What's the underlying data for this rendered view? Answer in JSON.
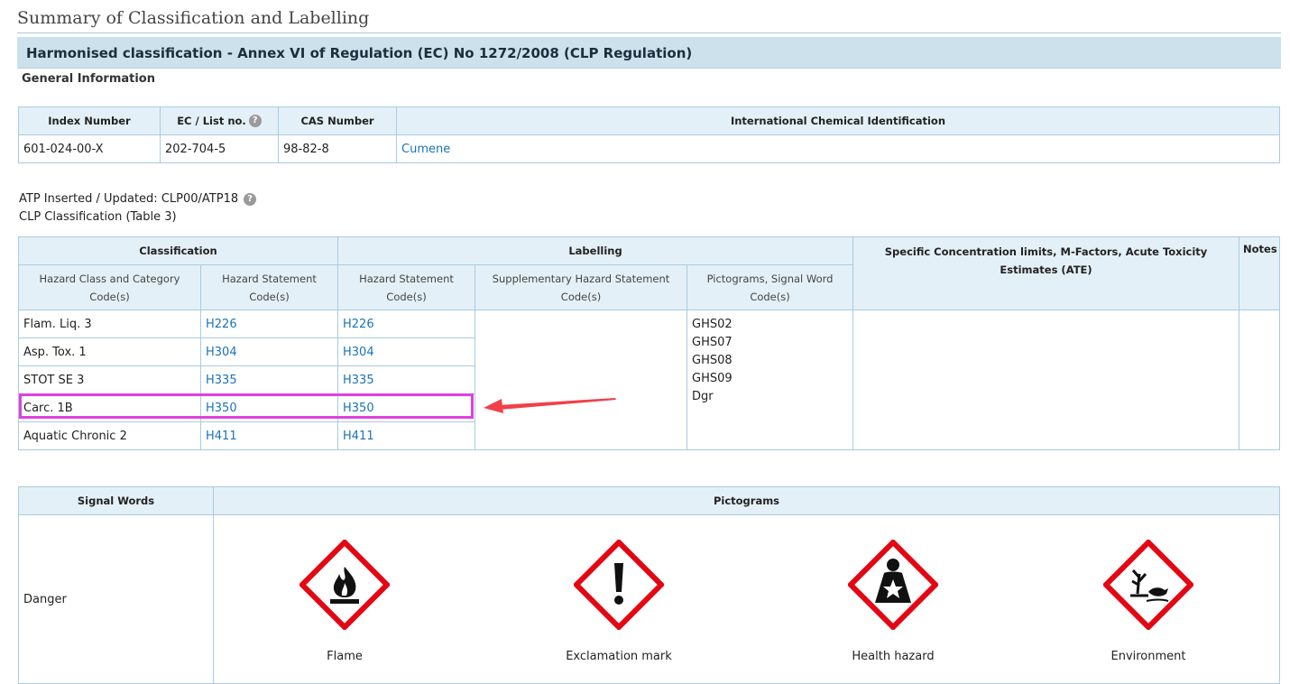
{
  "page_title": "Summary of Classification and Labelling",
  "section_title": "Harmonised classification - Annex VI of Regulation (EC) No 1272/2008 (CLP Regulation)",
  "general_info_label": "General Information",
  "general_table": {
    "headers": {
      "index": "Index Number",
      "ec": "EC / List no.",
      "cas": "CAS Number",
      "ici": "International Chemical Identification"
    },
    "row": {
      "index": "601-024-00-X",
      "ec": "202-704-5",
      "cas": "98-82-8",
      "ici": "Cumene"
    }
  },
  "help_icon_glyph": "?",
  "atp_text": "ATP Inserted / Updated: CLP00/ATP18",
  "clp_text": "CLP Classification (Table 3)",
  "clp_table": {
    "group_headers": {
      "classification": "Classification",
      "labelling": "Labelling",
      "scl": "Specific Concentration limits, M-Factors, Acute Toxicity Estimates (ATE)",
      "notes": "Notes"
    },
    "sub_headers": {
      "hazard_class": [
        "Hazard Class and Category",
        "Code(s)"
      ],
      "hazard_statement": [
        "Hazard Statement",
        "Code(s)"
      ],
      "label_hazard_statement": [
        "Hazard Statement",
        "Code(s)"
      ],
      "supplementary": [
        "Supplementary Hazard Statement",
        "Code(s)"
      ],
      "pictograms": [
        "Pictograms, Signal Word",
        "Code(s)"
      ]
    },
    "rows": [
      {
        "class": "Flam. Liq. 3",
        "hs": "H226",
        "lhs": "H226"
      },
      {
        "class": "Asp. Tox. 1",
        "hs": "H304",
        "lhs": "H304"
      },
      {
        "class": "STOT SE 3",
        "hs": "H335",
        "lhs": "H335"
      },
      {
        "class": "Carc. 1B",
        "hs": "H350",
        "lhs": "H350"
      },
      {
        "class": "Aquatic Chronic 2",
        "hs": "H411",
        "lhs": "H411"
      }
    ],
    "pictogram_codes": [
      "GHS02",
      "GHS07",
      "GHS08",
      "GHS09",
      "Dgr"
    ]
  },
  "signal_table": {
    "headers": {
      "signal_words": "Signal Words",
      "pictograms": "Pictograms"
    },
    "signal_word": "Danger",
    "pictograms": [
      {
        "label": "Flame",
        "icon": "flame-icon"
      },
      {
        "label": "Exclamation mark",
        "icon": "exclamation-mark-icon"
      },
      {
        "label": "Health hazard",
        "icon": "health-hazard-icon"
      },
      {
        "label": "Environment",
        "icon": "environment-icon"
      }
    ]
  },
  "colors": {
    "ghs_red": "#e30613",
    "highlight": "#e040e0",
    "arrow": "#f0404a",
    "link": "#1a73b8",
    "header_bg": "#e4f0f7"
  }
}
